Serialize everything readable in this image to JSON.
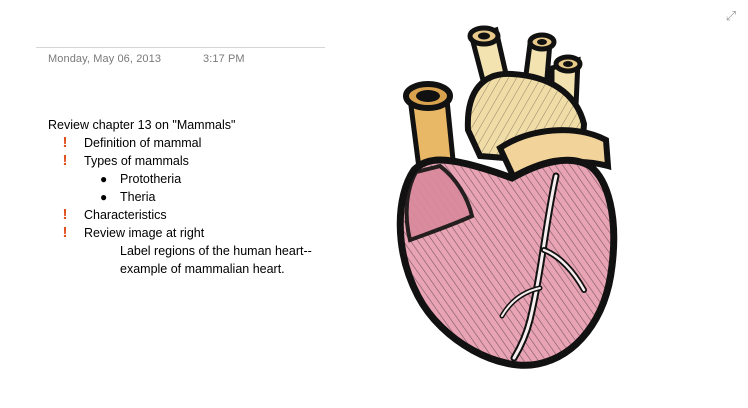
{
  "page": {
    "date": "Monday, May 06, 2013",
    "time": "3:17 PM"
  },
  "note": {
    "heading": "Review chapter 13 on \"Mammals\"",
    "items": [
      {
        "text": "Definition of mammal",
        "tag": "important"
      },
      {
        "text": "Types of mammals",
        "tag": "important",
        "children": [
          "Prototheria",
          "Theria"
        ]
      },
      {
        "text": "Characteristics",
        "tag": "important"
      },
      {
        "text": "Review image at right",
        "tag": "important",
        "detail": [
          "Label regions of the human heart--",
          "example of mammalian heart."
        ]
      }
    ]
  },
  "icons": {
    "expand": "expand-icon",
    "important": "exclamation-icon",
    "bullet": "bullet-dot-icon"
  },
  "colors": {
    "important_tag": "#e0501f",
    "meta_text": "#7a7a7a"
  }
}
